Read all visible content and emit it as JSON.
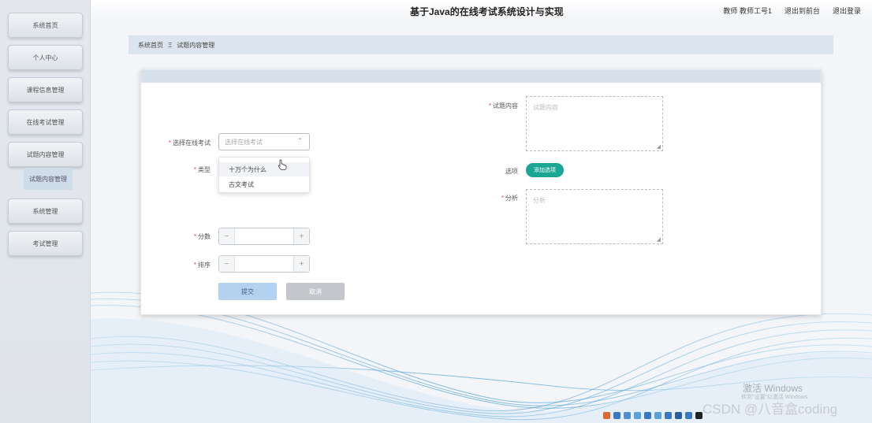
{
  "header": {
    "title": "基于Java的在线考试系统设计与实现",
    "user_role": "教师",
    "user_name": "教师工号1",
    "goto_front": "退出到前台",
    "logout": "退出登录"
  },
  "sidebar": {
    "items": [
      {
        "label": "系统首页"
      },
      {
        "label": "个人中心"
      },
      {
        "label": "课程信息管理"
      },
      {
        "label": "在线考试管理"
      },
      {
        "label": "试题内容管理"
      },
      {
        "label": "系统管理"
      },
      {
        "label": "考试管理"
      }
    ],
    "active_sub": "试题内容管理"
  },
  "breadcrumb": {
    "home": "系统首页",
    "separator": "Ξ",
    "current": "试题内容管理"
  },
  "form": {
    "exam_label": "选择在线考试",
    "exam_placeholder": "选择在线考试",
    "exam_options": [
      "十万个为什么",
      "古文考试"
    ],
    "type_label": "类型",
    "score_label": "分数",
    "order_label": "排序",
    "content_label": "试题内容",
    "content_placeholder": "试题内容",
    "options_label": "选项",
    "add_option": "添加选项",
    "analysis_label": "分析",
    "analysis_placeholder": "分析",
    "submit": "提交",
    "cancel": "取消"
  },
  "overlays": {
    "activate_windows": "激活 Windows",
    "activate_hint": "转到\"设置\"以激活 Windows",
    "watermark": "CSDN @八音盒coding"
  },
  "colors": {
    "accent": "#1aa594",
    "submit_bg": "#b2d2ef",
    "cancel_bg": "#c3c7cc",
    "breadcrumb_bg": "#dce5ef",
    "required": "#e5484d"
  }
}
